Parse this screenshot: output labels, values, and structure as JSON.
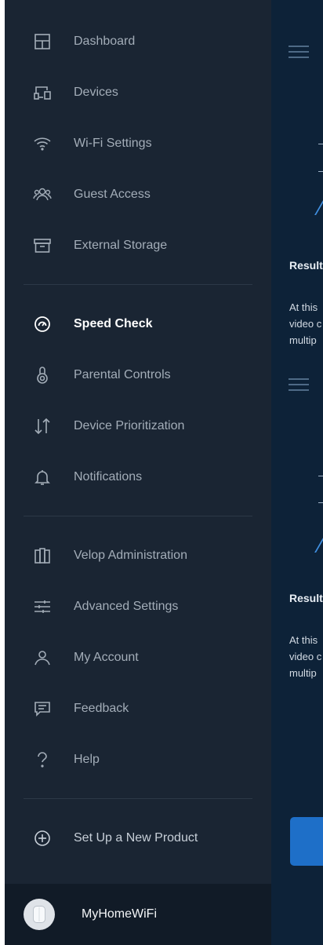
{
  "menu": {
    "items": [
      {
        "label": "Dashboard",
        "icon": "dashboard-icon"
      },
      {
        "label": "Devices",
        "icon": "devices-icon"
      },
      {
        "label": "Wi-Fi Settings",
        "icon": "wifi-icon"
      },
      {
        "label": "Guest Access",
        "icon": "guest-access-icon"
      },
      {
        "label": "External Storage",
        "icon": "storage-icon"
      },
      {
        "label": "Speed Check",
        "icon": "speedometer-icon",
        "active": true
      },
      {
        "label": "Parental Controls",
        "icon": "parental-controls-icon"
      },
      {
        "label": "Device Prioritization",
        "icon": "prioritization-arrows-icon"
      },
      {
        "label": "Notifications",
        "icon": "bell-icon"
      },
      {
        "label": "Velop Administration",
        "icon": "velop-node-icon"
      },
      {
        "label": "Advanced Settings",
        "icon": "sliders-icon"
      },
      {
        "label": "My Account",
        "icon": "user-icon"
      },
      {
        "label": "Feedback",
        "icon": "feedback-bubble-icon"
      },
      {
        "label": "Help",
        "icon": "question-icon"
      },
      {
        "label": "Set Up a New Product",
        "icon": "add-circle-icon"
      }
    ]
  },
  "footer": {
    "network_name": "MyHomeWiFi",
    "icon": "velop-node-avatar-icon"
  },
  "content": {
    "result_label_1": "Result",
    "text_1": [
      "At this",
      "video c",
      "multip"
    ],
    "result_label_2": "Result",
    "text_2": [
      "At this",
      "video c",
      "multip"
    ]
  },
  "colors": {
    "drawer_bg": "#1a2533",
    "content_bg": "#0d2238",
    "accent": "#1e6fc8",
    "active_text": "#ffffff",
    "inactive_text": "#a3adb8"
  }
}
